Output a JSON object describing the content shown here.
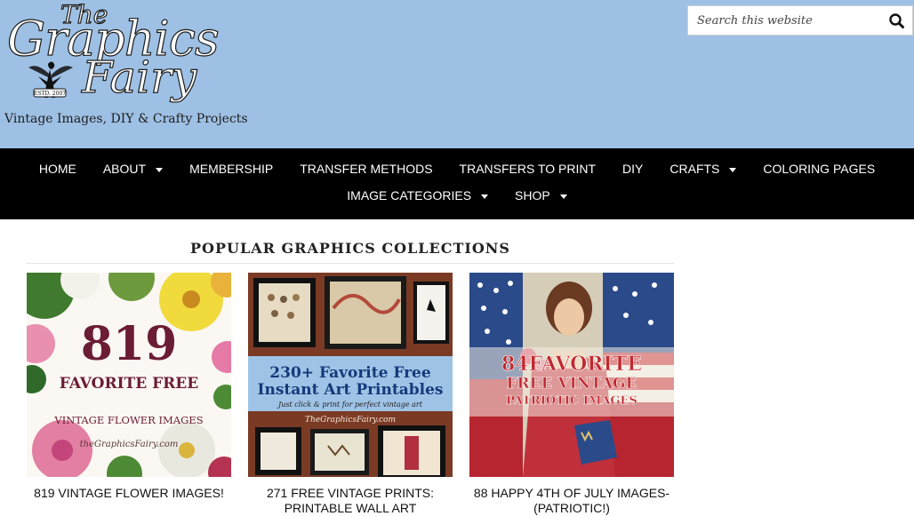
{
  "site": {
    "logo": {
      "line1": "The",
      "line2": "Graphics",
      "line3": "Fairy",
      "tagline": "Vintage Images, DIY & Crafty Projects",
      "badge": "ESTD. 2007"
    },
    "search": {
      "placeholder": "Search this website",
      "icon": "search-icon"
    }
  },
  "nav": {
    "row1": [
      {
        "label": "HOME",
        "dropdown": false
      },
      {
        "label": "ABOUT",
        "dropdown": true
      },
      {
        "label": "MEMBERSHIP",
        "dropdown": false
      },
      {
        "label": "TRANSFER METHODS",
        "dropdown": false
      },
      {
        "label": "TRANSFERS TO PRINT",
        "dropdown": false
      },
      {
        "label": "DIY",
        "dropdown": false
      },
      {
        "label": "CRAFTS",
        "dropdown": true
      },
      {
        "label": "COLORING PAGES",
        "dropdown": false
      }
    ],
    "row2": [
      {
        "label": "IMAGE CATEGORIES",
        "dropdown": true
      },
      {
        "label": "SHOP",
        "dropdown": true
      }
    ]
  },
  "main": {
    "section_title": "POPULAR GRAPHICS COLLECTIONS",
    "cards": [
      {
        "caption": "819 VINTAGE FLOWER IMAGES!",
        "thumb_big": "819",
        "thumb_line1": "FAVORITE FREE",
        "thumb_line2": "VINTAGE FLOWER IMAGES",
        "thumb_credit": "theGraphicsFairy.com"
      },
      {
        "caption": "271 FREE VINTAGE PRINTS: PRINTABLE WALL ART",
        "thumb_line1": "230+ Favorite Free",
        "thumb_line2": "Instant Art Printables",
        "thumb_line3": "Just click & print for perfect vintage art",
        "thumb_credit": "TheGraphicsFairy.com"
      },
      {
        "caption": "88 HAPPY 4TH OF JULY IMAGES- (PATRIOTIC!)",
        "thumb_line1": "84FAVORITE",
        "thumb_line2": "FREE VINTAGE",
        "thumb_line3": "PATRIOTIC IMAGES"
      }
    ]
  },
  "colors": {
    "header_bg": "#9ec0e4",
    "nav_bg": "#000000",
    "nav_text": "#ffffff"
  }
}
